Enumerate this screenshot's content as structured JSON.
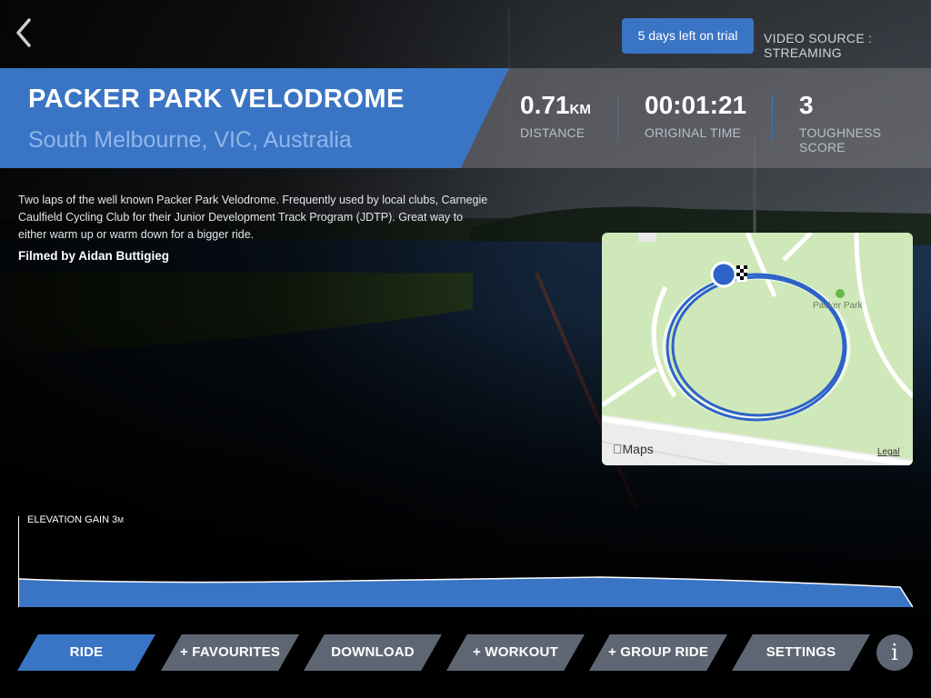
{
  "header": {
    "trial_label": "5 days left on trial",
    "video_source": "VIDEO SOURCE : STREAMING"
  },
  "ride": {
    "title": "PACKER PARK VELODROME",
    "location": "South Melbourne, VIC, Australia",
    "description": "Two laps of the well known Packer Park Velodrome. Frequently used by local clubs, Carnegie Caulfield Cycling Club for their Junior Development Track Program (JDTP). Great way to either warm up or warm down for a bigger ride.",
    "credit": "Filmed by Aidan Buttigieg"
  },
  "stats": {
    "distance_value": "0.71",
    "distance_unit": "KM",
    "distance_label": "DISTANCE",
    "time_value": "00:01:21",
    "time_label": "ORIGINAL TIME",
    "toughness_value": "3",
    "toughness_label": "TOUGHNESS SCORE"
  },
  "map": {
    "logo": "Maps",
    "legal": "Legal",
    "poi": "Packer Park"
  },
  "elevation": {
    "label": "ELEVATION GAIN 3",
    "unit": "M"
  },
  "nav": {
    "ride": "RIDE",
    "favourites": "+ FAVOURITES",
    "download": "DOWNLOAD",
    "workout": "+ WORKOUT",
    "group_ride": "+ GROUP RIDE",
    "settings": "SETTINGS",
    "info": "i"
  },
  "colors": {
    "accent": "#3a74c4",
    "button_gray": "#5f6673",
    "map_green": "#cfe8b9"
  }
}
